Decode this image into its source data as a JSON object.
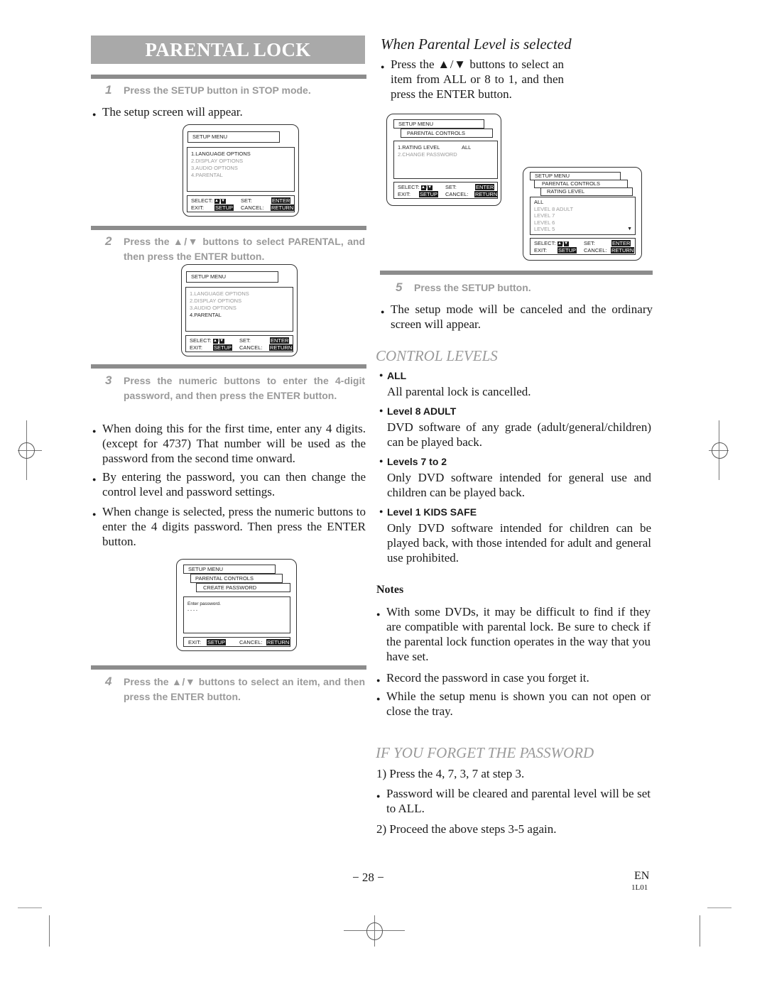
{
  "page": {
    "title": "PARENTAL LOCK",
    "page_number": "− 28 −",
    "language_code": "EN",
    "doc_code": "1L01"
  },
  "left": {
    "step1": {
      "num": "1",
      "text": "Press the SETUP button in STOP mode."
    },
    "step1_note": "The setup screen will appear.",
    "osd1": {
      "header": "SETUP MENU",
      "items": [
        "1.LANGUAGE OPTIONS",
        "2.DISPLAY OPTIONS",
        "3.AUDIO OPTIONS",
        "4.PARENTAL"
      ],
      "selected_index": 0,
      "footer": {
        "select": "SELECT:",
        "set": "SET:",
        "enter": "ENTER",
        "exit": "EXIT:",
        "setup": "SETUP",
        "cancel": "CANCEL:",
        "return": "RETURN"
      }
    },
    "step2": {
      "num": "2",
      "text": "Press the ▲/▼ buttons to select PARENTAL, and then press the ENTER button."
    },
    "osd2": {
      "header": "SETUP MENU",
      "items": [
        "1.LANGUAGE OPTIONS",
        "2.DISPLAY OPTIONS",
        "3.AUDIO OPTIONS",
        "4.PARENTAL"
      ],
      "selected_index": 3,
      "footer": {
        "select": "SELECT:",
        "set": "SET:",
        "enter": "ENTER",
        "exit": "EXIT:",
        "setup": "SETUP",
        "cancel": "CANCEL:",
        "return": "RETURN"
      }
    },
    "step3": {
      "num": "3",
      "text": "Press the numeric buttons to enter the 4-digit password, and then press the ENTER button."
    },
    "step3_notes": [
      "When doing this for the first time, enter any 4 digits. (except for 4737) That number will be used as the password from the second time onward.",
      "By entering the password, you can then change the control level and password settings.",
      "When change is selected, press the numeric buttons to enter the 4 digits password. Then press the ENTER button."
    ],
    "osd3": {
      "tabs": [
        "SETUP MENU",
        "PARENTAL CONTROLS",
        "CREATE PASSWORD"
      ],
      "prompt": "Enter password.",
      "value": "- - - -",
      "footer": {
        "exit": "EXIT:",
        "setup": "SETUP",
        "cancel": "CANCEL:",
        "return": "RETURN"
      }
    },
    "step4": {
      "num": "4",
      "text": "Press the ▲/▼ buttons to select an item, and then press the ENTER button."
    }
  },
  "right": {
    "section_title": "When Parental Level is selected",
    "intro": "Press the ▲/▼ buttons to select an item from ALL or 8 to 1, and then press the ENTER button.",
    "osd4": {
      "tabs": [
        "SETUP MENU",
        "PARENTAL CONTROLS"
      ],
      "items": [
        {
          "label": "1.RATING LEVEL",
          "value": "ALL",
          "active": true
        },
        {
          "label": "2.CHANGE PASSWORD",
          "value": "",
          "active": false
        }
      ],
      "footer": {
        "select": "SELECT:",
        "set": "SET:",
        "enter": "ENTER",
        "exit": "EXIT:",
        "setup": "SETUP",
        "cancel": "CANCEL:",
        "return": "RETURN"
      }
    },
    "osd5": {
      "tabs": [
        "SETUP MENU",
        "PARENTAL CONTROLS",
        "RATING LEVEL"
      ],
      "items": [
        "ALL",
        "LEVEL 8 ADULT",
        "LEVEL 7",
        "LEVEL 6",
        "LEVEL 5"
      ],
      "selected_index": 0,
      "scroll_indicator": "▼",
      "footer": {
        "select": "SELECT:",
        "set": "SET:",
        "enter": "ENTER",
        "exit": "EXIT:",
        "setup": "SETUP",
        "cancel": "CANCEL:",
        "return": "RETURN"
      }
    },
    "step5": {
      "num": "5",
      "text": "Press the SETUP button."
    },
    "step5_note": "The setup mode will be canceled and the ordinary screen will appear.",
    "control_levels": {
      "title": "CONTROL LEVELS",
      "levels": [
        {
          "name": "ALL",
          "desc": "All parental lock is cancelled."
        },
        {
          "name": "Level 8 ADULT",
          "desc": "DVD software of any grade (adult/general/children) can be played back."
        },
        {
          "name": "Levels 7 to 2",
          "desc": "Only DVD software intended for general use and children can be played back."
        },
        {
          "name": "Level 1 KIDS SAFE",
          "desc": "Only DVD software intended for children can be played back, with those intended for adult and general use prohibited."
        }
      ]
    },
    "notes": {
      "title": "Notes",
      "items": [
        "With some DVDs, it may be difficult to find if they are compatible with parental lock. Be sure to check if the parental lock function operates in the way that you have set.",
        "Record the password in case you forget it.",
        "While the setup menu is shown you can not open or close the tray."
      ]
    },
    "forget": {
      "title": "IF YOU FORGET THE PASSWORD",
      "step1": "1) Press the 4, 7, 3, 7 at step 3.",
      "step1_note": "Password will be cleared and parental level will be set to ALL.",
      "step2": "2) Proceed the above steps 3-5 again."
    }
  },
  "bullet_glyph": "●",
  "arrows": {
    "up": "▲",
    "down": "▼"
  }
}
